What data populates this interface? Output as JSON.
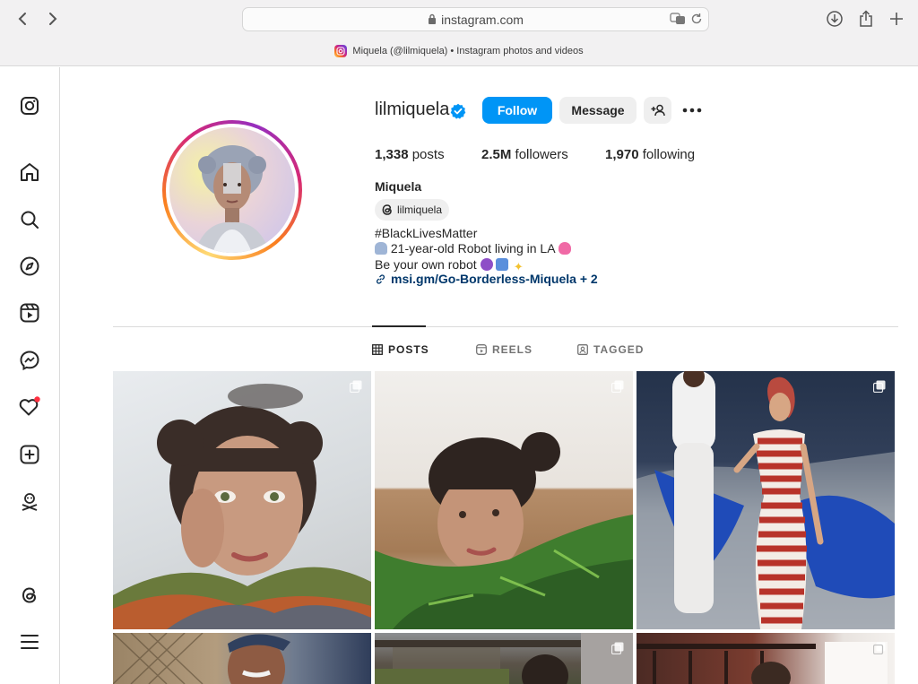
{
  "browser": {
    "url": "instagram.com",
    "tab_title": "Miquela (@lilmiquela) • Instagram photos and videos"
  },
  "profile": {
    "username": "lilmiquela",
    "verified": true,
    "follow_label": "Follow",
    "message_label": "Message",
    "posts_count": "1,338",
    "posts_label": "posts",
    "followers_count": "2.5M",
    "followers_label": "followers",
    "following_count": "1,970",
    "following_label": "following",
    "full_name": "Miquela",
    "threads_handle": "lilmiquela",
    "bio": {
      "line1": "#BlackLivesMatter",
      "line2": "21-year-old Robot living in LA",
      "line3": "Be your own robot",
      "link": "msi.gm/Go-Borderless-Miquela + 2"
    }
  },
  "tabs": [
    {
      "label": "POSTS",
      "active": true
    },
    {
      "label": "REELS",
      "active": false
    },
    {
      "label": "TAGGED",
      "active": false
    }
  ],
  "sidebar": {
    "items": [
      "instagram-logo",
      "home",
      "search",
      "explore",
      "reels",
      "messenger",
      "notifications",
      "create",
      "profile",
      "threads",
      "more"
    ]
  },
  "colors": {
    "primary_button": "#0095f6",
    "link": "#00376b",
    "notification_dot": "#ff3040"
  }
}
